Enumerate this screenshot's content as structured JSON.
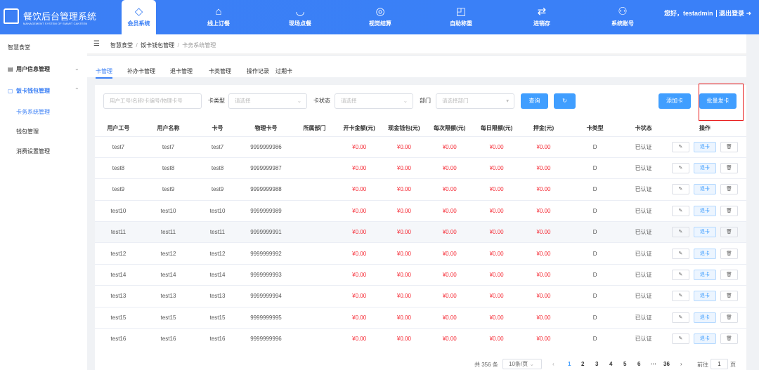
{
  "app": {
    "title": "餐饮后台管理系统",
    "subtitle": "MANAGEMENT SYSTEM OF SMART CANTEEN",
    "logo_text": "智慧食堂",
    "accent": "#3a7ff5"
  },
  "nav": [
    {
      "label": "会员系统",
      "icon": "diamond-icon",
      "glyph": "◇",
      "active": true
    },
    {
      "label": "线上订餐",
      "icon": "shop-icon",
      "glyph": "⌂"
    },
    {
      "label": "现场点餐",
      "icon": "bowl-icon",
      "glyph": "◡"
    },
    {
      "label": "视觉结算",
      "icon": "scan-eye-icon",
      "glyph": "◎"
    },
    {
      "label": "自助称重",
      "icon": "scale-icon",
      "glyph": "◰"
    },
    {
      "label": "进销存",
      "icon": "exchange-icon",
      "glyph": "⇄"
    },
    {
      "label": "系统账号",
      "icon": "users-icon",
      "glyph": "⚇"
    }
  ],
  "user": {
    "greeting": "您好，testadmin",
    "logout": "退出登录"
  },
  "sidebar": {
    "root": "智慧食堂",
    "items": [
      {
        "label": "用户信息管理",
        "icon": "id-card-icon"
      },
      {
        "label": "饭卡钱包管理",
        "icon": "card-icon",
        "active": true,
        "children": [
          "卡务系统管理",
          "钱包管理",
          "消费设置管理"
        ]
      }
    ]
  },
  "breadcrumb": [
    "智慧食堂",
    "饭卡钱包管理",
    "卡务系统管理"
  ],
  "tabs": [
    "卡管理",
    "补办卡管理",
    "退卡管理",
    "卡类管理",
    "操作记录",
    "过期卡"
  ],
  "filters": {
    "search_placeholder": "用户工号/名称/卡编号/物理卡号",
    "card_type_label": "卡类型",
    "card_type_placeholder": "请选择",
    "card_status_label": "卡状态",
    "card_status_placeholder": "请选择",
    "dept_label": "部门",
    "dept_placeholder": "请选择部门",
    "query": "查询",
    "add_card": "添加卡",
    "batch_issue": "批量发卡"
  },
  "table": {
    "columns": [
      "用户工号",
      "用户名称",
      "卡号",
      "物理卡号",
      "所属部门",
      "开卡金额(元)",
      "现金钱包(元)",
      "每次限额(元)",
      "每日限额(元)",
      "押金(元)",
      "卡类型",
      "卡状态",
      "操作"
    ],
    "rows": [
      [
        "test7",
        "test7",
        "test7",
        "9999999986",
        "",
        "¥0.00",
        "¥0.00",
        "¥0.00",
        "¥0.00",
        "¥0.00",
        "D",
        "已认证"
      ],
      [
        "test8",
        "test8",
        "test8",
        "9999999987",
        "",
        "¥0.00",
        "¥0.00",
        "¥0.00",
        "¥0.00",
        "¥0.00",
        "D",
        "已认证"
      ],
      [
        "test9",
        "test9",
        "test9",
        "9999999988",
        "",
        "¥0.00",
        "¥0.00",
        "¥0.00",
        "¥0.00",
        "¥0.00",
        "D",
        "已认证"
      ],
      [
        "test10",
        "test10",
        "test10",
        "9999999989",
        "",
        "¥0.00",
        "¥0.00",
        "¥0.00",
        "¥0.00",
        "¥0.00",
        "D",
        "已认证"
      ],
      [
        "test11",
        "test11",
        "test11",
        "9999999991",
        "",
        "¥0.00",
        "¥0.00",
        "¥0.00",
        "¥0.00",
        "¥0.00",
        "D",
        "已认证"
      ],
      [
        "test12",
        "test12",
        "test12",
        "9999999992",
        "",
        "¥0.00",
        "¥0.00",
        "¥0.00",
        "¥0.00",
        "¥0.00",
        "D",
        "已认证"
      ],
      [
        "test14",
        "test14",
        "test14",
        "9999999993",
        "",
        "¥0.00",
        "¥0.00",
        "¥0.00",
        "¥0.00",
        "¥0.00",
        "D",
        "已认证"
      ],
      [
        "test13",
        "test13",
        "test13",
        "9999999994",
        "",
        "¥0.00",
        "¥0.00",
        "¥0.00",
        "¥0.00",
        "¥0.00",
        "D",
        "已认证"
      ],
      [
        "test15",
        "test15",
        "test15",
        "9999999995",
        "",
        "¥0.00",
        "¥0.00",
        "¥0.00",
        "¥0.00",
        "¥0.00",
        "D",
        "已认证"
      ],
      [
        "test16",
        "test16",
        "test16",
        "9999999996",
        "",
        "¥0.00",
        "¥0.00",
        "¥0.00",
        "¥0.00",
        "¥0.00",
        "D",
        "已认证"
      ]
    ],
    "row_action": "退卡"
  },
  "pagination": {
    "total": "共 356 条",
    "page_size": "10条/页",
    "pages": [
      "1",
      "2",
      "3",
      "4",
      "5",
      "6",
      "···",
      "36"
    ],
    "current": "1",
    "goto_label": "前往",
    "goto_value": "1",
    "goto_suffix": "页"
  }
}
